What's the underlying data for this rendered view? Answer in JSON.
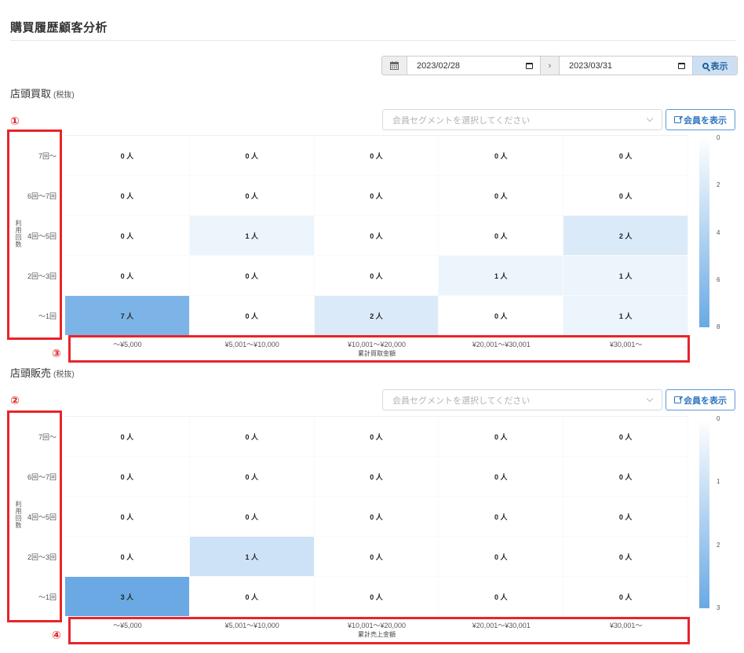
{
  "page_title": "購買履歴顧客分析",
  "date_range": {
    "start": "2023/02/28",
    "end": "2023/03/31",
    "separator": "›",
    "show_label": "表示"
  },
  "sections": [
    {
      "heading": "店頭買取",
      "heading_note": "(税抜)",
      "badge": "①",
      "select_placeholder": "会員セグメントを選択してください",
      "segment_button": "会員を表示",
      "y_axis_title": "利用回数",
      "row_labels": [
        "7回〜",
        "6回〜7回",
        "4回〜5回",
        "2回〜3回",
        "〜1回"
      ],
      "col_labels": [
        "〜¥5,000",
        "¥5,001〜¥10,000",
        "¥10,001〜¥20,000",
        "¥20,001〜¥30,001",
        "¥30,001〜"
      ],
      "x_axis_title": "累計買取金額",
      "x_badge": "③",
      "cells": [
        [
          "0 人",
          "0 人",
          "0 人",
          "0 人",
          "0 人"
        ],
        [
          "0 人",
          "0 人",
          "0 人",
          "0 人",
          "0 人"
        ],
        [
          "0 人",
          "1 人",
          "0 人",
          "0 人",
          "2 人"
        ],
        [
          "0 人",
          "0 人",
          "0 人",
          "1 人",
          "1 人"
        ],
        [
          "7 人",
          "0 人",
          "2 人",
          "0 人",
          "1 人"
        ]
      ],
      "values": [
        [
          0,
          0,
          0,
          0,
          0
        ],
        [
          0,
          0,
          0,
          0,
          0
        ],
        [
          0,
          1,
          0,
          0,
          2
        ],
        [
          0,
          0,
          0,
          1,
          1
        ],
        [
          7,
          0,
          2,
          0,
          1
        ]
      ],
      "scale_max": 8,
      "legend_ticks": [
        "0",
        "2",
        "4",
        "6",
        "8"
      ]
    },
    {
      "heading": "店頭販売",
      "heading_note": "(税抜)",
      "badge": "②",
      "select_placeholder": "会員セグメントを選択してください",
      "segment_button": "会員を表示",
      "y_axis_title": "利用回数",
      "row_labels": [
        "7回〜",
        "6回〜7回",
        "4回〜5回",
        "2回〜3回",
        "〜1回"
      ],
      "col_labels": [
        "〜¥5,000",
        "¥5,001〜¥10,000",
        "¥10,001〜¥20,000",
        "¥20,001〜¥30,001",
        "¥30,001〜"
      ],
      "x_axis_title": "累計売上金額",
      "x_badge": "④",
      "cells": [
        [
          "0 人",
          "0 人",
          "0 人",
          "0 人",
          "0 人"
        ],
        [
          "0 人",
          "0 人",
          "0 人",
          "0 人",
          "0 人"
        ],
        [
          "0 人",
          "0 人",
          "0 人",
          "0 人",
          "0 人"
        ],
        [
          "0 人",
          "1 人",
          "0 人",
          "0 人",
          "0 人"
        ],
        [
          "3 人",
          "0 人",
          "0 人",
          "0 人",
          "0 人"
        ]
      ],
      "values": [
        [
          0,
          0,
          0,
          0,
          0
        ],
        [
          0,
          0,
          0,
          0,
          0
        ],
        [
          0,
          0,
          0,
          0,
          0
        ],
        [
          0,
          1,
          0,
          0,
          0
        ],
        [
          3,
          0,
          0,
          0,
          0
        ]
      ],
      "scale_max": 3,
      "legend_ticks": [
        "0",
        "1",
        "2",
        "3"
      ]
    }
  ],
  "colors": {
    "scale_low": "#ffffff",
    "scale_high": "#6aa9e4",
    "annotation_red": "#e8242a",
    "accent_blue": "#2e75c0"
  }
}
